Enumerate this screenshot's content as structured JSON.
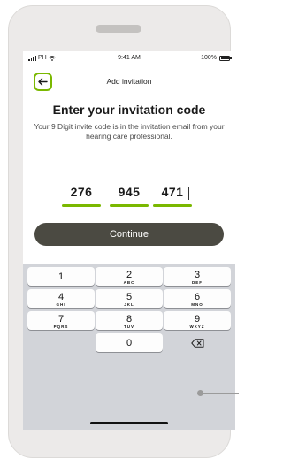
{
  "status_bar": {
    "carrier": "PH",
    "time": "9:41 AM",
    "battery": "100%"
  },
  "nav": {
    "title": "Add invitation",
    "back_icon": "arrow-left-icon"
  },
  "heading": "Enter your invitation code",
  "subtext": "Your 9 Digit invite code is in the invitation email from your hearing care professional.",
  "code": {
    "groups": [
      "276",
      "945",
      "471"
    ]
  },
  "continue_label": "Continue",
  "keypad": {
    "keys": [
      {
        "num": "1",
        "letters": ""
      },
      {
        "num": "2",
        "letters": "ABC"
      },
      {
        "num": "3",
        "letters": "DEF"
      },
      {
        "num": "4",
        "letters": "GHI"
      },
      {
        "num": "5",
        "letters": "JKL"
      },
      {
        "num": "6",
        "letters": "MNO"
      },
      {
        "num": "7",
        "letters": "PQRS"
      },
      {
        "num": "8",
        "letters": "TUV"
      },
      {
        "num": "9",
        "letters": "WXYZ"
      },
      {
        "num": "0",
        "letters": ""
      }
    ],
    "delete_icon": "backspace-icon"
  },
  "colors": {
    "accent": "#7ab800",
    "button": "#4b4a42",
    "keypad_bg": "#d2d4d9"
  }
}
